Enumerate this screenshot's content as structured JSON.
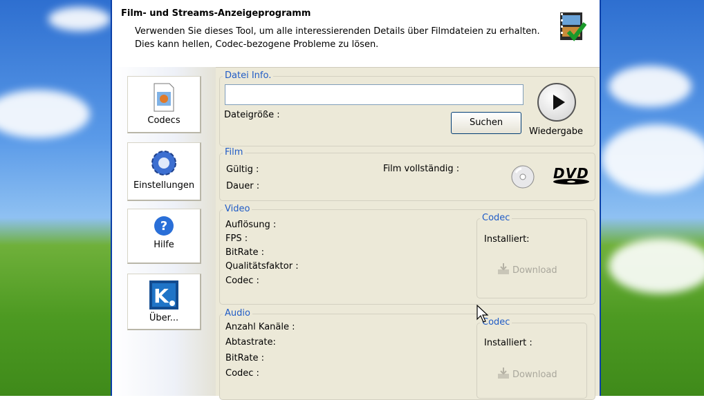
{
  "banner": {
    "title": "Film- und Streams-Anzeigeprogramm",
    "desc_line1": "Verwenden Sie dieses Tool, um alle interessierenden Details über Filmdateien zu erhalten.",
    "desc_line2": "Dies kann hellen, Codec-bezogene Probleme zu lösen."
  },
  "nav": [
    {
      "label": "Codecs",
      "icon": "codecs-icon"
    },
    {
      "label": "Einstellungen",
      "icon": "gear-icon"
    },
    {
      "label": "Hilfe",
      "icon": "help-icon"
    },
    {
      "label": "Über...",
      "icon": "about-icon"
    }
  ],
  "file_info": {
    "title": "Datei Info.",
    "path_value": "",
    "size_label": "Dateigröße :",
    "search_label": "Suchen",
    "play_label": "Wiedergabe"
  },
  "film": {
    "title": "Film",
    "valid_label": "Gültig :",
    "duration_label": "Dauer :",
    "complete_label": "Film vollständig :",
    "dvd_text": "DVD"
  },
  "video": {
    "title": "Video",
    "labels": [
      "Auflösung :",
      "FPS :",
      "BitRate :",
      "Qualitätsfaktor :",
      "Codec :"
    ],
    "codec_box": {
      "title": "Codec",
      "installed_label": "Installiert:",
      "download_label": "Download"
    }
  },
  "audio": {
    "title": "Audio",
    "labels": [
      "Anzahl Kanäle :",
      "Abtastrate:",
      "BitRate :",
      "Codec :"
    ],
    "codec_box": {
      "title": "Codec",
      "installed_label": "Installiert :",
      "download_label": "Download"
    }
  },
  "colors": {
    "accent": "#1f5bc6",
    "window_bg": "#ece9d8",
    "xp_border": "#0a3fa8"
  }
}
